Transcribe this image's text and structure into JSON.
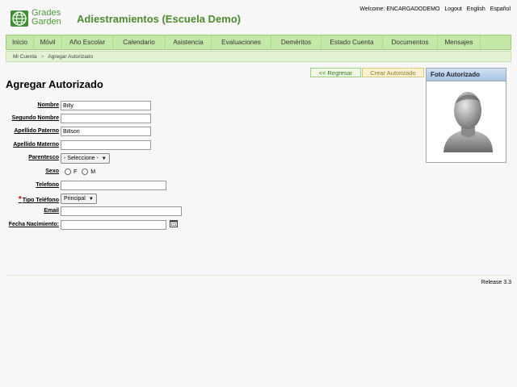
{
  "header": {
    "logo_line1": "Grades",
    "logo_line2": "Garden",
    "app_title": "Adiestramientos (Escuela Demo)",
    "welcome": "Welcome: ENCARGADODEMO",
    "logout": "Logout",
    "english": "English",
    "espanol": "Español"
  },
  "nav": {
    "items": [
      {
        "label": "Inicio"
      },
      {
        "label": "Móvil"
      },
      {
        "label": "Año Escolar"
      },
      {
        "label": "Calendario"
      },
      {
        "label": "Asistencia"
      },
      {
        "label": "Evaluaciones"
      },
      {
        "label": "Deméritos"
      },
      {
        "label": "Estado Cuenta"
      },
      {
        "label": "Documentos"
      },
      {
        "label": "Mensajes"
      }
    ]
  },
  "breadcrumb": {
    "root": "Mi Cuenta",
    "separator": ">",
    "current": "Agregar Autorizado"
  },
  "actions": {
    "back": "<< Regresar",
    "create": "Crear Autorizado"
  },
  "photo_panel": {
    "title": "Foto Autorizado"
  },
  "form": {
    "title": "Agregar Autorizado",
    "nombre": {
      "label": "Nombre",
      "value": "Billy"
    },
    "segundo_nombre": {
      "label": "Segundo Nombre",
      "value": ""
    },
    "apellido_paterno": {
      "label": "Apellido Paterno",
      "value": "Billson"
    },
    "apellido_materno": {
      "label": "Apellido Materno",
      "value": ""
    },
    "parentesco": {
      "label": "Parentesco",
      "value": "- Seleccione -"
    },
    "sexo": {
      "label": "Sexo",
      "option_f": "F",
      "option_m": "M"
    },
    "telefono": {
      "label": "Telefono",
      "value": ""
    },
    "tipo_telefono": {
      "label": "Tipo Teléfono",
      "required_mark": "*",
      "value": "Principal"
    },
    "email": {
      "label": "Email",
      "value": ""
    },
    "fecha_nacimiento": {
      "label": "Fecha Nacimiento:",
      "value": ""
    }
  },
  "footer": {
    "release": "Release 3.3"
  },
  "colors": {
    "brand_green": "#4c8b2e",
    "nav_bg": "#c4e8a8",
    "required": "#cc0000"
  }
}
